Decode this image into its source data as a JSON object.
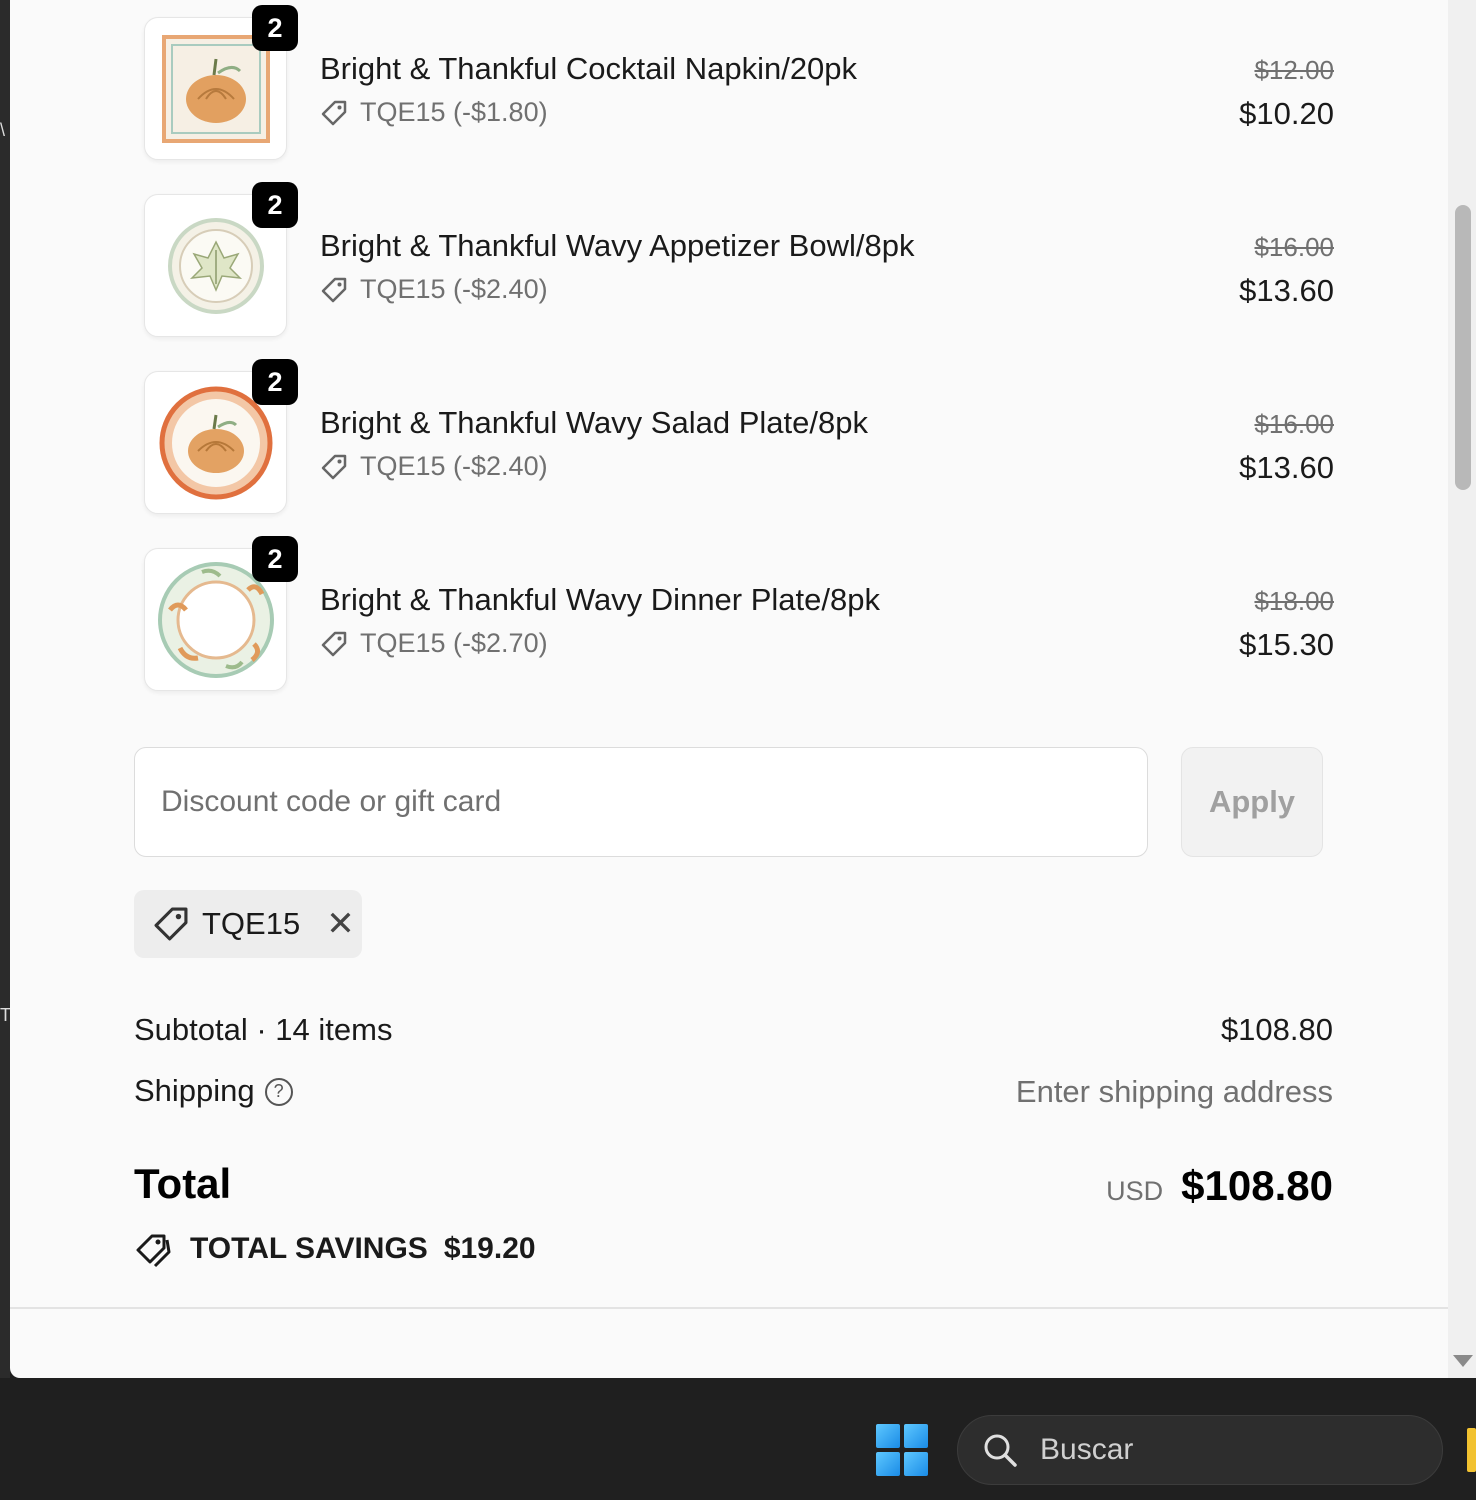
{
  "cart": {
    "items": [
      {
        "name": "Bright & Thankful Cocktail Napkin/20pk",
        "qty": "2",
        "discount": "TQE15 (-$1.80)",
        "price_original": "$12.00",
        "price_final": "$10.20",
        "image_icon": "pumpkin-napkin-icon"
      },
      {
        "name": "Bright & Thankful Wavy Appetizer Bowl/8pk",
        "qty": "2",
        "discount": "TQE15 (-$2.40)",
        "price_original": "$16.00",
        "price_final": "$13.60",
        "image_icon": "leaf-bowl-icon"
      },
      {
        "name": "Bright & Thankful Wavy Salad Plate/8pk",
        "qty": "2",
        "discount": "TQE15 (-$2.40)",
        "price_original": "$16.00",
        "price_final": "$13.60",
        "image_icon": "pumpkin-plate-icon"
      },
      {
        "name": "Bright & Thankful Wavy Dinner Plate/8pk",
        "qty": "2",
        "discount": "TQE15 (-$2.70)",
        "price_original": "$18.00",
        "price_final": "$15.30",
        "image_icon": "leaf-plate-icon"
      }
    ]
  },
  "discount": {
    "placeholder": "Discount code or gift card",
    "apply_label": "Apply",
    "applied_code": "TQE15"
  },
  "summary": {
    "subtotal_label": "Subtotal · 14 items",
    "subtotal_value": "$108.80",
    "shipping_label": "Shipping",
    "shipping_value": "Enter shipping address",
    "total_label": "Total",
    "currency": "USD",
    "total_value": "$108.80",
    "savings_label": "TOTAL SAVINGS",
    "savings_value": "$19.20"
  },
  "taskbar": {
    "search_placeholder": "Buscar"
  },
  "colors": {
    "background": "#fafafa",
    "text": "#1a1a1a",
    "muted": "#707070",
    "badge": "#000000",
    "taskbar": "#202020"
  }
}
